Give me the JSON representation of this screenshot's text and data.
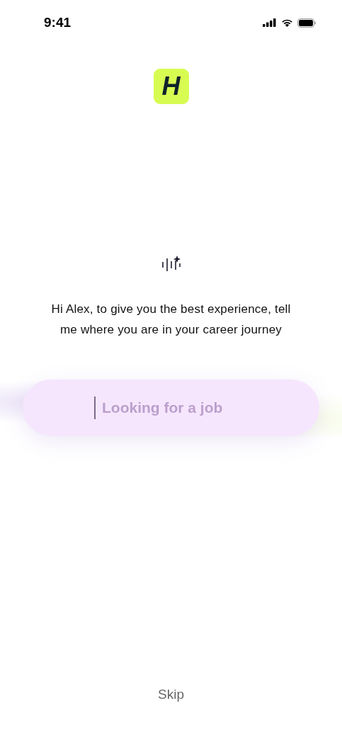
{
  "status_bar": {
    "time": "9:41"
  },
  "logo": {
    "letter": "H"
  },
  "prompt": "Hi Alex, to give you the best experience, tell me where you are in your career journey",
  "answer_field": {
    "placeholder": "Looking for a job"
  },
  "skip_button": {
    "label": "Skip"
  }
}
